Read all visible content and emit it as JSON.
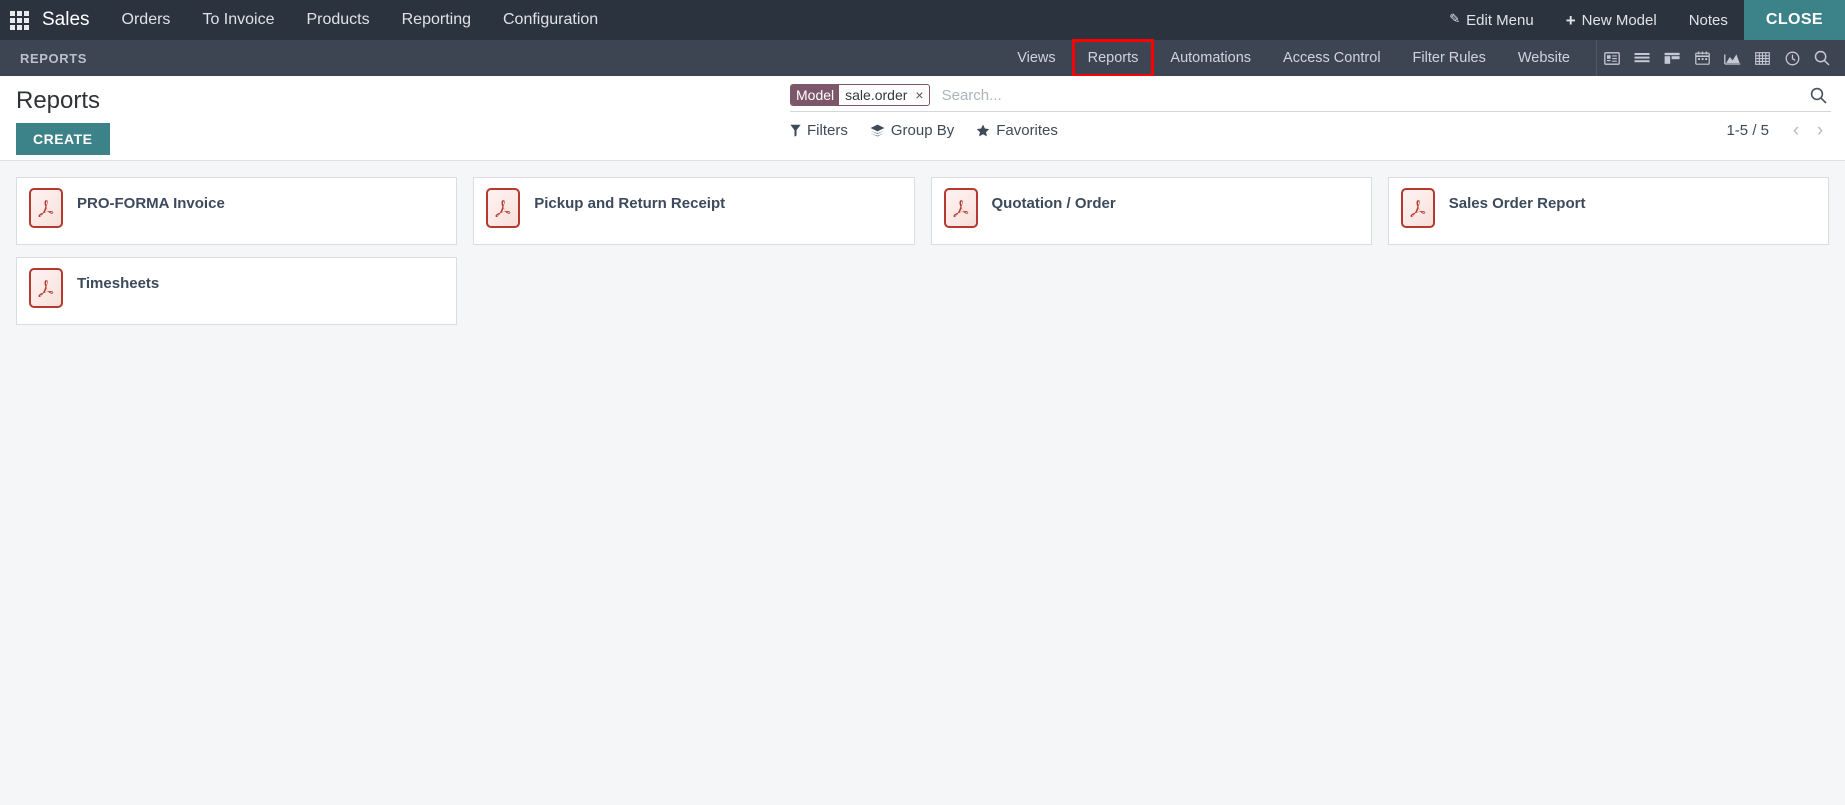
{
  "app_bar": {
    "apps_icon": "apps-grid-icon",
    "brand": "Sales",
    "menus": [
      {
        "label": "Orders"
      },
      {
        "label": "To Invoice"
      },
      {
        "label": "Products"
      },
      {
        "label": "Reporting"
      },
      {
        "label": "Configuration"
      }
    ],
    "systray": [
      {
        "label": "Edit Menu",
        "icon": "pencil-icon"
      },
      {
        "label": "New Model",
        "icon": "plus-icon"
      },
      {
        "label": "Notes",
        "icon": ""
      }
    ],
    "close_label": "CLOSE"
  },
  "studio_bar": {
    "title": "REPORTS",
    "tabs": [
      {
        "label": "Views",
        "highlighted": false
      },
      {
        "label": "Reports",
        "highlighted": true
      },
      {
        "label": "Automations",
        "highlighted": false
      },
      {
        "label": "Access Control",
        "highlighted": false
      },
      {
        "label": "Filter Rules",
        "highlighted": false
      },
      {
        "label": "Website",
        "highlighted": false
      }
    ],
    "highlight_color": "#ff0000",
    "view_icons": [
      {
        "name": "contact-card-icon"
      },
      {
        "name": "list-view-icon"
      },
      {
        "name": "kanban-view-icon"
      },
      {
        "name": "calendar-view-icon"
      },
      {
        "name": "graph-view-icon"
      },
      {
        "name": "pivot-view-icon"
      },
      {
        "name": "activity-clock-icon"
      },
      {
        "name": "search-icon"
      }
    ]
  },
  "control_panel": {
    "page_title": "Reports",
    "create_label": "CREATE",
    "search": {
      "facet_label": "Model",
      "facet_value": "sale.order",
      "facet_remove": "×",
      "placeholder": "Search...",
      "value": "",
      "facet_color": "#7c5769"
    },
    "filters_label": "Filters",
    "group_by_label": "Group By",
    "favorites_label": "Favorites",
    "pager_count": "1-5 / 5"
  },
  "reports": [
    {
      "title": "PRO-FORMA Invoice",
      "icon": "pdf-file-icon"
    },
    {
      "title": "Pickup and Return Receipt",
      "icon": "pdf-file-icon"
    },
    {
      "title": "Quotation / Order",
      "icon": "pdf-file-icon"
    },
    {
      "title": "Sales Order Report",
      "icon": "pdf-file-icon"
    },
    {
      "title": "Timesheets",
      "icon": "pdf-file-icon"
    }
  ],
  "theme": {
    "app_bar_bg": "#2b333f",
    "studio_bar_bg": "#3d4452",
    "accent_teal": "#3c8389",
    "pdf_red": "#b5392e",
    "content_bg": "#f4f6f8"
  }
}
